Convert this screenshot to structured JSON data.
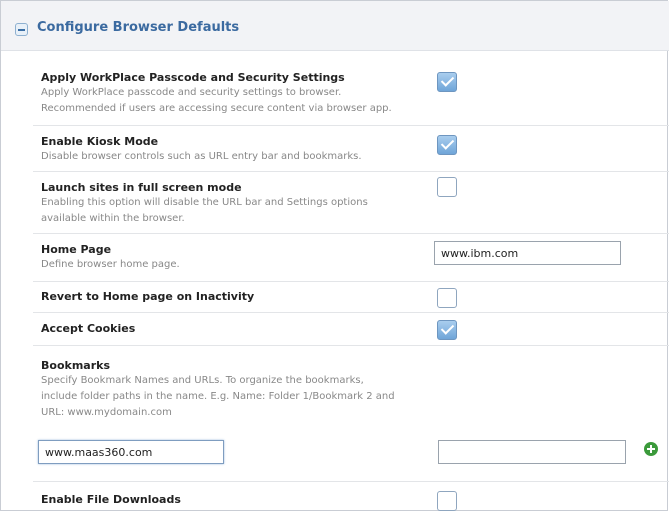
{
  "panel": {
    "title": "Configure Browser Defaults"
  },
  "settings": {
    "passcode": {
      "title": "Apply WorkPlace Passcode and Security Settings",
      "desc1": "Apply WorkPlace passcode and security settings to browser.",
      "desc2": "Recommended if users are accessing secure content via browser app.",
      "checked": true
    },
    "kiosk": {
      "title": "Enable Kiosk Mode",
      "desc1": "Disable browser controls such as URL entry bar and bookmarks.",
      "checked": true
    },
    "fullscreen": {
      "title": "Launch sites in full screen mode",
      "desc1": "Enabling this option will disable the URL bar and Settings options",
      "desc2": "available within the browser.",
      "checked": false
    },
    "homepage": {
      "title": "Home Page",
      "desc1": "Define browser home page.",
      "value": "www.ibm.com"
    },
    "revert": {
      "title": "Revert to Home page on Inactivity",
      "checked": false
    },
    "cookies": {
      "title": "Accept Cookies",
      "checked": true
    },
    "bookmarks": {
      "title": "Bookmarks",
      "desc1": "Specify Bookmark Names and URLs. To organize the bookmarks,",
      "desc2": "include folder paths in the name. E.g. Name: Folder 1/Bookmark 2 and",
      "desc3": "URL: www.mydomain.com",
      "url_value": "www.maas360.com",
      "name_value": ""
    },
    "downloads": {
      "title": "Enable File Downloads",
      "checked": false
    }
  },
  "icons": {
    "collapse": "minus-square-icon",
    "add": "plus-circle-icon"
  }
}
